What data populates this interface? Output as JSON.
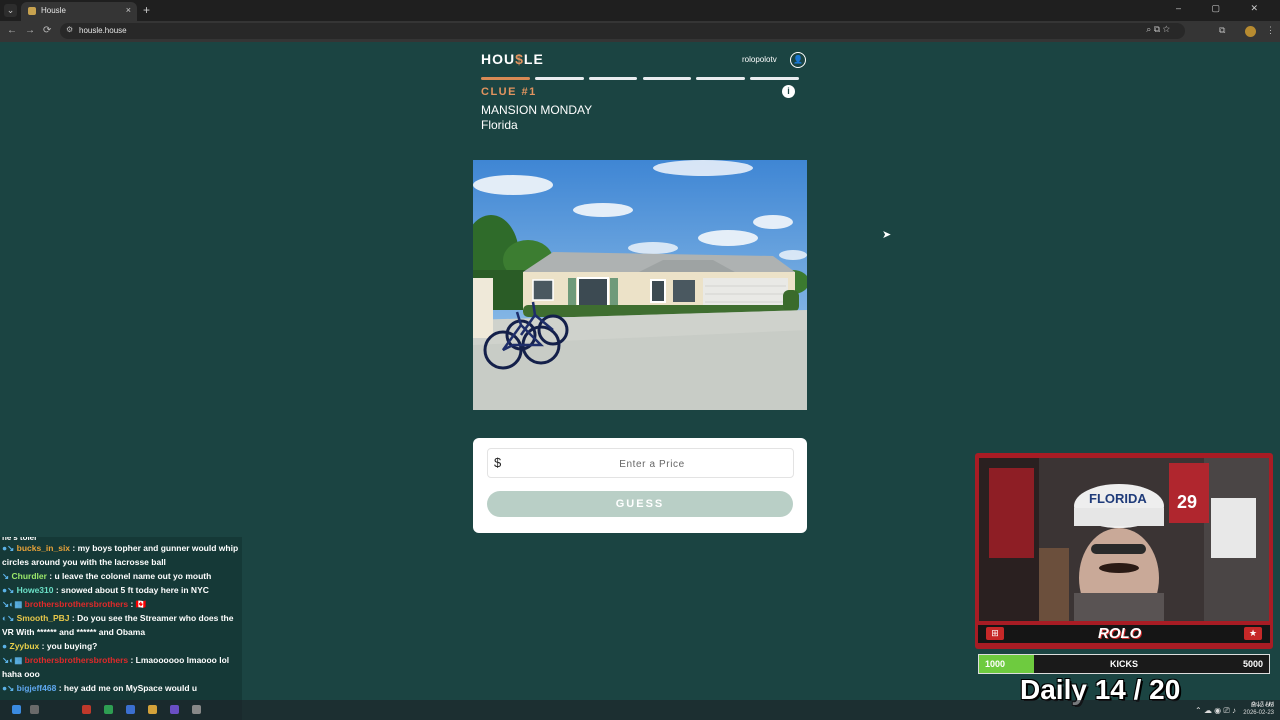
{
  "browser": {
    "tab_title": "Housle",
    "tab_close": "×",
    "new_tab": "+",
    "url": "housle.house",
    "window_controls": "–  ▢  ✕",
    "nav_back": "←",
    "nav_forward": "→",
    "nav_reload": "⟳",
    "url_icons": "⌕  ⧉  ☆"
  },
  "game": {
    "logo_prefix": "HOU",
    "logo_dollar": "$",
    "logo_suffix": "LE",
    "username": "rolopolotv",
    "user_icon": "👤",
    "progress_segments": 6,
    "progress_current": 1,
    "clue_label": "CLUE #1",
    "info_icon": "i",
    "theme": "MANSION MONDAY",
    "location": "Florida",
    "currency_symbol": "$",
    "price_placeholder": "Enter a Price",
    "guess_label": "GUESS"
  },
  "chat": {
    "cut_text": "he's toler",
    "messages": [
      {
        "badges": "●↘",
        "user": "bucks_in_six",
        "user_color": "#e8a33a",
        "text": " : my boys topher and gunner would whip circles around you with the lacrosse ball"
      },
      {
        "badges": "↘",
        "user": "Churdler",
        "user_color": "#9be86a",
        "text": " : u leave the colonel name out yo mouth"
      },
      {
        "badges": "●↘",
        "user": "Howe310",
        "user_color": "#6be0c7",
        "text": " : snowed about 5 ft today here in NYC"
      },
      {
        "badges": "↘◐▦",
        "user": "brothersbrothersbrothers",
        "user_color": "#e02a2a",
        "text": " : 🇨🇦"
      },
      {
        "badges": "◐↘",
        "user": "Smooth_PBJ",
        "user_color": "#e8c84a",
        "text": " : Do you see the Streamer who does the VR With ****** and ****** and Obama"
      },
      {
        "badges": "●",
        "user": "Zyybux",
        "user_color": "#e8d04a",
        "text": " : you buying?"
      },
      {
        "badges": "↘◐▦",
        "user": "brothersbrothersbrothers",
        "user_color": "#e02a2a",
        "text": " : Lmaoooooo lmaooo lol haha ooo"
      },
      {
        "badges": "●↘",
        "user": "bigjeff468",
        "user_color": "#5fa8f0",
        "text": " : hey add me on MySpace would u"
      }
    ]
  },
  "stream": {
    "cam_badge": "⊞",
    "cam_logo": "ROLO",
    "cam_star": "★",
    "goal_min": "1000",
    "goal_label": "KICKS",
    "goal_max": "5000",
    "goal_fill_fraction": 0.19,
    "daily": "Daily  14 / 20"
  },
  "taskbar": {
    "lang": "ENG US",
    "time": "9:17 AM",
    "date": "2026-02-23",
    "tray_icons": "⌃ ☁ ◉ ⎚ ♪"
  },
  "colors": {
    "page_bg": "#1b4442",
    "accent": "#d98a55",
    "guess_button": "#b9cfc6"
  }
}
